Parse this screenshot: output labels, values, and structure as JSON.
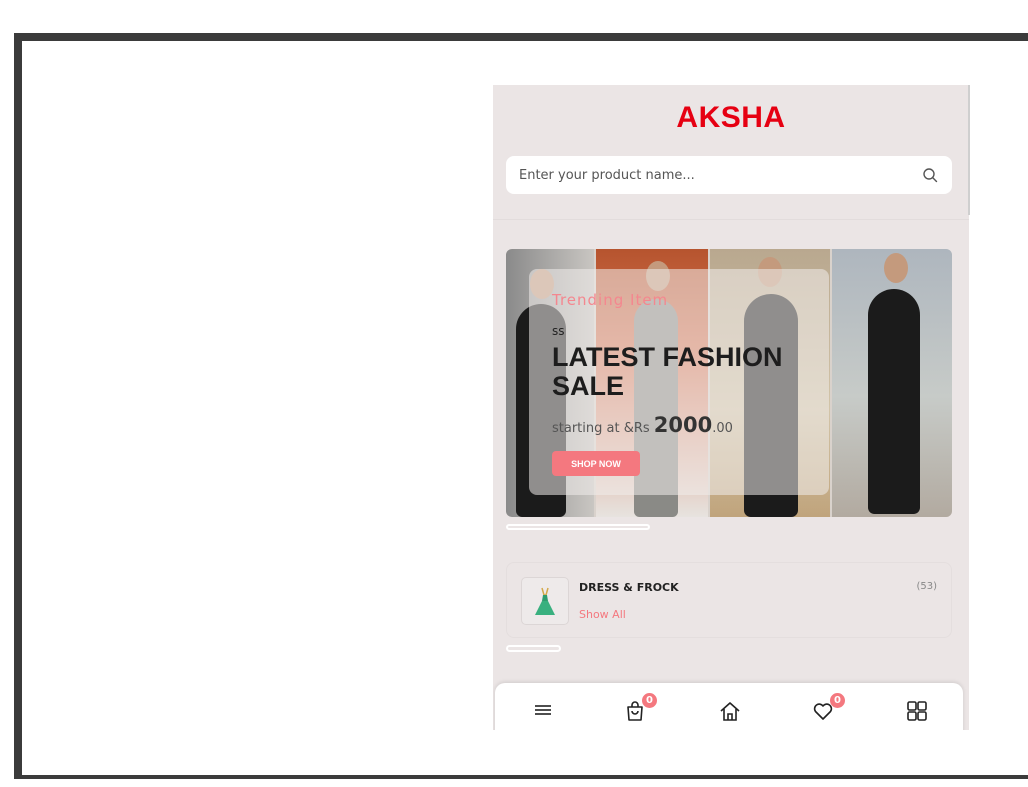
{
  "app": {
    "logo": "AKSHA",
    "search": {
      "placeholder": "Enter your product name..."
    }
  },
  "banner": {
    "subtitle": "Trending Item",
    "tag": "ss",
    "headline": "LATEST FASHION SALE",
    "price_prefix": "starting at &Rs",
    "price_main": "2000",
    "price_decimal": ".00",
    "cta": "SHOP NOW"
  },
  "category": {
    "name": "DRESS & FROCK",
    "count": "(53)",
    "link": "Show All",
    "icon": "dress-icon"
  },
  "bottom_nav": {
    "items": [
      {
        "icon": "menu-icon"
      },
      {
        "icon": "shopping-bag-icon",
        "badge": "0"
      },
      {
        "icon": "home-icon"
      },
      {
        "icon": "heart-icon",
        "badge": "0"
      },
      {
        "icon": "grid-icon"
      }
    ]
  },
  "colors": {
    "brand": "#e60012",
    "accent": "#f4787f",
    "background": "#ebe5e5"
  }
}
